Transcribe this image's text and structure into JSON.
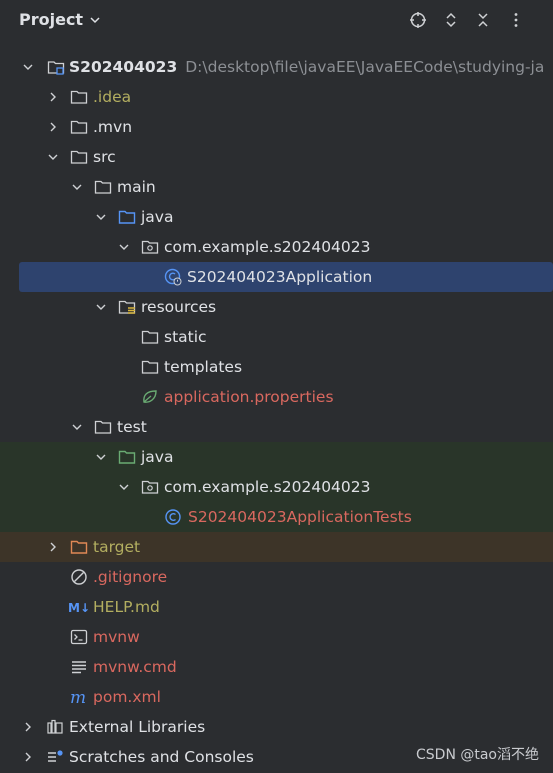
{
  "header": {
    "title": "Project",
    "icons": [
      "locate-icon",
      "expand-icon",
      "collapse-icon",
      "more-icon"
    ]
  },
  "tree": {
    "root": {
      "name": "S202404023",
      "path": "D:\\desktop\\file\\javaEE\\JavaEECode\\studying-ja"
    },
    "idea": ".idea",
    "mvn": ".mvn",
    "src": "src",
    "main": "main",
    "main_java": "java",
    "main_pkg": "com.example.s202404023",
    "app_class": "S202404023Application",
    "resources": "resources",
    "static": "static",
    "templates": "templates",
    "app_props": "application.properties",
    "test": "test",
    "test_java": "java",
    "test_pkg": "com.example.s202404023",
    "test_class": "S202404023ApplicationTests",
    "target": "target",
    "gitignore": ".gitignore",
    "help": "HELP.md",
    "mvnw": "mvnw",
    "mvnw_cmd": "mvnw.cmd",
    "pom": "pom.xml",
    "ext_libs": "External Libraries",
    "scratches": "Scratches and Consoles"
  },
  "watermark": "CSDN @tao滔不绝",
  "colors": {
    "background": "#2b2d30",
    "selection": "#2e436e",
    "test_highlight": "#293529",
    "target_highlight": "#3d3428",
    "excluded_yellow": "#b3ae60",
    "modified_red": "#d9685f",
    "accent_blue": "#5694f5"
  }
}
